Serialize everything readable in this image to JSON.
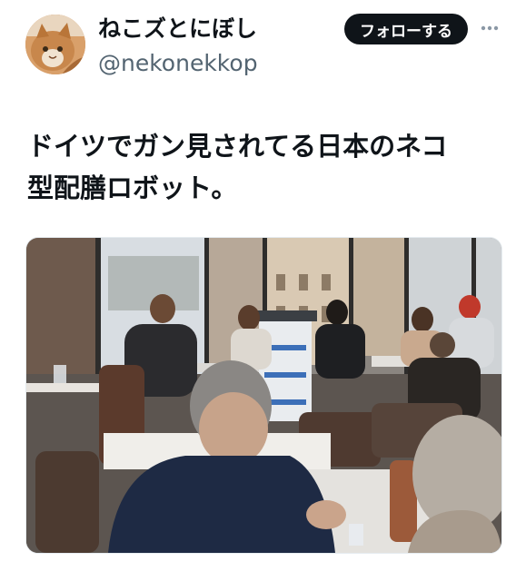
{
  "author": {
    "display_name": "ねこズとにぼし",
    "handle": "@nekonekkop"
  },
  "actions": {
    "follow_label": "フォローする",
    "more_icon": "more-horizontal-icon"
  },
  "tweet": {
    "text": "ドイツでガン見されてる日本のネコ\n型配膳ロボット。"
  },
  "colors": {
    "text": "#0f1419",
    "secondary_text": "#536471",
    "follow_button_bg": "#0f1419",
    "follow_button_text": "#ffffff"
  }
}
